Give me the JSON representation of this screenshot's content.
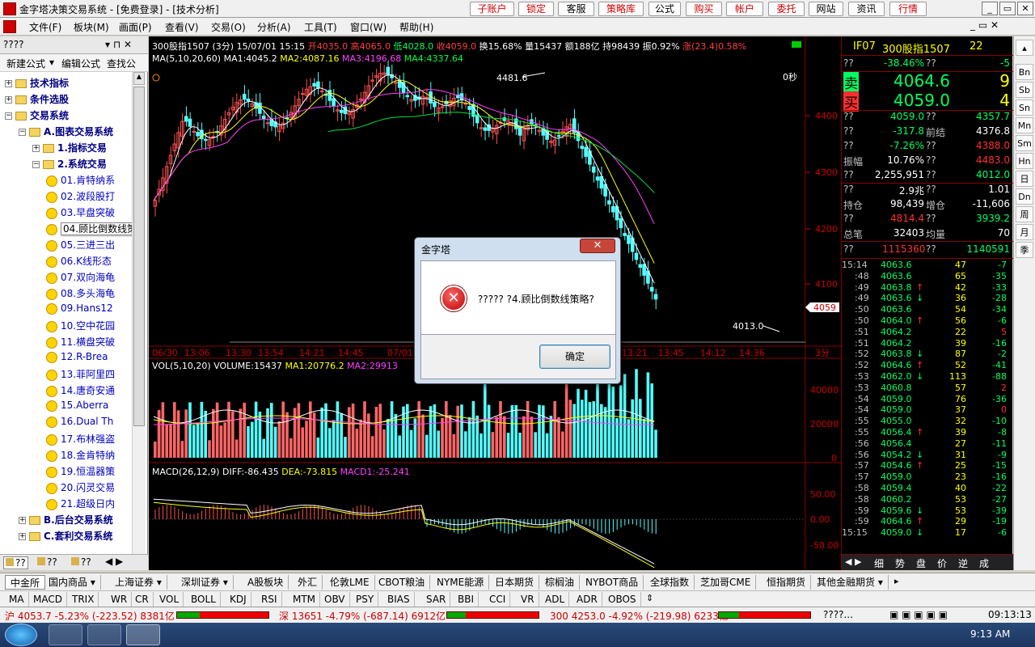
{
  "window": {
    "title": "金字塔决策交易系统 - [免费登录] - [技术分析]",
    "top_buttons": [
      "子账户",
      "锁定",
      "客服",
      "策略库",
      "公式",
      "购买",
      "帐户",
      "委托",
      "网站",
      "资讯",
      "行情"
    ],
    "controls": [
      "_",
      "▭",
      "✕"
    ]
  },
  "menu": [
    "文件(F)",
    "板块(M)",
    "画面(P)",
    "查看(V)",
    "交易(O)",
    "分析(A)",
    "工具(T)",
    "窗口(W)",
    "帮助(H)"
  ],
  "left_panel": {
    "header": "????",
    "tools": [
      "新建公式",
      "编辑公式",
      "查找公"
    ],
    "tree": [
      {
        "level": 0,
        "type": "folder",
        "label": "技术指标",
        "expander": "+"
      },
      {
        "level": 0,
        "type": "folder",
        "label": "条件选股",
        "expander": "+"
      },
      {
        "level": 0,
        "type": "folder",
        "label": "交易系统",
        "expander": "−"
      },
      {
        "level": 1,
        "type": "folder",
        "label": "A.图表交易系统",
        "expander": "−"
      },
      {
        "level": 2,
        "type": "folder",
        "label": "1.指标交易",
        "expander": "+"
      },
      {
        "level": 2,
        "type": "folder",
        "label": "2.系统交易",
        "expander": "−"
      },
      {
        "level": 3,
        "type": "item",
        "label": "01.肯特纳系"
      },
      {
        "level": 3,
        "type": "item",
        "label": "02.波段股打"
      },
      {
        "level": 3,
        "type": "item",
        "label": "03.早盘突破"
      },
      {
        "level": 3,
        "type": "item",
        "label": "04.顾比倒数线策略",
        "selected": true
      },
      {
        "level": 3,
        "type": "item",
        "label": "05.三进三出"
      },
      {
        "level": 3,
        "type": "item",
        "label": "06.K线形态"
      },
      {
        "level": 3,
        "type": "item",
        "label": "07.双向海龟"
      },
      {
        "level": 3,
        "type": "item",
        "label": "08.多头海龟"
      },
      {
        "level": 3,
        "type": "item",
        "label": "09.Hans12"
      },
      {
        "level": 3,
        "type": "item",
        "label": "10.空中花园"
      },
      {
        "level": 3,
        "type": "item",
        "label": "11.横盘突破"
      },
      {
        "level": 3,
        "type": "item",
        "label": "12.R-Brea"
      },
      {
        "level": 3,
        "type": "item",
        "label": "13.菲阿里四"
      },
      {
        "level": 3,
        "type": "item",
        "label": "14.唐奇安通"
      },
      {
        "level": 3,
        "type": "item",
        "label": "15.Aberra"
      },
      {
        "level": 3,
        "type": "item",
        "label": "16.Dual Th"
      },
      {
        "level": 3,
        "type": "item",
        "label": "17.布林强盗"
      },
      {
        "level": 3,
        "type": "item",
        "label": "18.金肯特纳"
      },
      {
        "level": 3,
        "type": "item",
        "label": "19.恒温器策"
      },
      {
        "level": 3,
        "type": "item",
        "label": "20.闪灵交易"
      },
      {
        "level": 3,
        "type": "item",
        "label": "21.超级日内"
      },
      {
        "level": 1,
        "type": "folder",
        "label": "B.后台交易系统",
        "expander": "+"
      },
      {
        "level": 1,
        "type": "folder",
        "label": "C.套利交易系统",
        "expander": "+"
      }
    ],
    "tabs": [
      "??",
      "??",
      "??"
    ]
  },
  "chart_header": {
    "line1": [
      {
        "t": "300股指1507 (3分) 15/07/01 15:15 ",
        "c": "#ffffff"
      },
      {
        "t": "开4035.0",
        "c": "#ff4040"
      },
      {
        "t": " 高4065.0",
        "c": "#ff4040"
      },
      {
        "t": " 低4028.0",
        "c": "#00ff60"
      },
      {
        "t": " 收4059.0",
        "c": "#ff4040"
      },
      {
        "t": " 换15.68% 量15437 额188亿 持98439 振0.92% ",
        "c": "#ffffff"
      },
      {
        "t": "涨(23.4)0.58%",
        "c": "#ff4040"
      }
    ],
    "line2": [
      {
        "t": "MA(5,10,20,60) ",
        "c": "#ffffff"
      },
      {
        "t": "MA1:4045.2",
        "c": "#ffffff"
      },
      {
        "t": " MA2:4087.16",
        "c": "#ffff00"
      },
      {
        "t": " MA3:4196.68",
        "c": "#ff40ff"
      },
      {
        "t": " MA4:4337.64",
        "c": "#00ff40"
      }
    ],
    "zero_sec": "0秒",
    "high_label": "4481.6",
    "low_label": "4013.0",
    "last_price_tag": "4059",
    "y_labels": [
      "4400",
      "4300",
      "4200",
      "4100"
    ],
    "x_labels": [
      "06/30",
      "13:06",
      "13:30",
      "13:54",
      "14:21",
      "14:45",
      "07/01",
      "13:21",
      "13:45",
      "14:12",
      "14:36"
    ],
    "period_label": "3分"
  },
  "vol_header": [
    {
      "t": "VOL(5,10,20) ",
      "c": "#ffffff"
    },
    {
      "t": "VOLUME:15437",
      "c": "#ffffff"
    },
    {
      "t": " MA1:20776.2",
      "c": "#ffff00"
    },
    {
      "t": " MA2:29913",
      "c": "#ff40ff"
    }
  ],
  "vol_y": [
    "40000",
    "20000",
    "0"
  ],
  "macd_header": [
    {
      "t": "MACD(26,12,9) ",
      "c": "#ffffff"
    },
    {
      "t": "DIFF:-86.435",
      "c": "#ffffff"
    },
    {
      "t": " DEA:-73.815",
      "c": "#ffff00"
    },
    {
      "t": " MACD1:-25.241",
      "c": "#ff40ff"
    }
  ],
  "macd_y": [
    "50.00",
    "0.00",
    "-50.00"
  ],
  "quote": {
    "header": {
      "code": "IF07",
      "name": "300股指1507",
      "num": "22"
    },
    "rows": [
      {
        "l": "??",
        "v": "-38.46%",
        "l2": "??",
        "v2": "-5",
        "vc": "#00ff60",
        "v2c": "#00ff60"
      },
      {
        "l": "卖",
        "v": "4064.6",
        "l2": "",
        "v2": "9",
        "vc": "#00ff60",
        "v2c": "#ffff00",
        "big": true,
        "lc": "#00ff60"
      },
      {
        "l": "买",
        "v": "4059.0",
        "l2": "",
        "v2": "4",
        "vc": "#00ff60",
        "v2c": "#ffff00",
        "big": true,
        "lc": "#ff3030"
      },
      {
        "l": "??",
        "v": "4059.0",
        "l2": "??",
        "v2": "4357.7",
        "vc": "#00ff60",
        "v2c": "#00ff60"
      },
      {
        "l": "??",
        "v": "-317.8",
        "l2": "前结",
        "v2": "4376.8",
        "vc": "#00ff60",
        "v2c": "#ffffff"
      },
      {
        "l": "??",
        "v": "-7.26%",
        "l2": "??",
        "v2": "4388.0",
        "vc": "#00ff60",
        "v2c": "#ff3030"
      },
      {
        "l": "振幅",
        "v": "10.76%",
        "l2": "??",
        "v2": "4483.0",
        "vc": "#ffffff",
        "v2c": "#ff3030"
      },
      {
        "l": "??",
        "v": "2,255,951",
        "l2": "??",
        "v2": "4012.0",
        "vc": "#ffffff",
        "v2c": "#00ff60"
      },
      {
        "l": "??",
        "v": "2.9兆",
        "l2": "??",
        "v2": "1.01",
        "vc": "#ffffff",
        "v2c": "#ffffff"
      },
      {
        "l": "持仓",
        "v": "98,439",
        "l2": "增仓",
        "v2": "-11,606",
        "vc": "#ffffff",
        "v2c": "#ffffff"
      },
      {
        "l": "??",
        "v": "4814.4",
        "l2": "??",
        "v2": "3939.2",
        "vc": "#ff3030",
        "v2c": "#00ff60"
      },
      {
        "l": "总笔",
        "v": "32403",
        "l2": "均量",
        "v2": "70",
        "vc": "#ffffff",
        "v2c": "#ffffff"
      }
    ],
    "out_in": {
      "l": "??",
      "v": "1115360",
      "l2": "??",
      "v2": "1140591"
    },
    "ticks": [
      {
        "t": "15:14",
        "p": "4063.6",
        "a": "",
        "v": "47",
        "d": "-7"
      },
      {
        "t": ":48",
        "p": "4063.6",
        "a": "",
        "v": "65",
        "d": "-35"
      },
      {
        "t": ":49",
        "p": "4063.8",
        "a": "↑",
        "v": "42",
        "d": "-33"
      },
      {
        "t": ":49",
        "p": "4063.6",
        "a": "↓",
        "v": "36",
        "d": "-28"
      },
      {
        "t": ":50",
        "p": "4063.6",
        "a": "",
        "v": "54",
        "d": "-34"
      },
      {
        "t": ":50",
        "p": "4064.0",
        "a": "↑",
        "v": "56",
        "d": "-6"
      },
      {
        "t": ":51",
        "p": "4064.2",
        "a": "",
        "v": "22",
        "d": "5"
      },
      {
        "t": ":51",
        "p": "4064.2",
        "a": "",
        "v": "39",
        "d": "-16"
      },
      {
        "t": ":52",
        "p": "4063.8",
        "a": "↓",
        "v": "87",
        "d": "-2"
      },
      {
        "t": ":52",
        "p": "4064.6",
        "a": "↑",
        "v": "52",
        "d": "-41"
      },
      {
        "t": ":53",
        "p": "4062.0",
        "a": "↓",
        "v": "113",
        "d": "-88"
      },
      {
        "t": ":53",
        "p": "4060.8",
        "a": "",
        "v": "57",
        "d": "2"
      },
      {
        "t": ":54",
        "p": "4059.0",
        "a": "",
        "v": "76",
        "d": "-36"
      },
      {
        "t": ":54",
        "p": "4059.0",
        "a": "",
        "v": "37",
        "d": "0"
      },
      {
        "t": ":55",
        "p": "4055.0",
        "a": "",
        "v": "32",
        "d": "-10"
      },
      {
        "t": ":55",
        "p": "4056.4",
        "a": "↑",
        "v": "39",
        "d": "-8"
      },
      {
        "t": ":56",
        "p": "4056.4",
        "a": "",
        "v": "27",
        "d": "-11"
      },
      {
        "t": ":56",
        "p": "4054.2",
        "a": "↓",
        "v": "31",
        "d": "-9"
      },
      {
        "t": ":57",
        "p": "4054.6",
        "a": "↑",
        "v": "25",
        "d": "-15"
      },
      {
        "t": ":57",
        "p": "4059.0",
        "a": "",
        "v": "23",
        "d": "-16"
      },
      {
        "t": ":58",
        "p": "4059.4",
        "a": "",
        "v": "40",
        "d": "-22"
      },
      {
        "t": ":58",
        "p": "4060.2",
        "a": "",
        "v": "53",
        "d": "-27"
      },
      {
        "t": ":59",
        "p": "4059.6",
        "a": "↓",
        "v": "53",
        "d": "-39"
      },
      {
        "t": ":59",
        "p": "4064.6",
        "a": "↑",
        "v": "29",
        "d": "-19"
      },
      {
        "t": "15:15",
        "p": "4059.0",
        "a": "↓",
        "v": "17",
        "d": "-6"
      }
    ],
    "bottom_tabs": [
      "细",
      "势",
      "盘",
      "价",
      "逆",
      "成"
    ]
  },
  "right_strip": [
    "Bn",
    "Sb",
    "Sn",
    "Mn",
    "Sm",
    "Hn",
    "日",
    "Dn",
    "周",
    "月",
    "季"
  ],
  "market_tabs": [
    "中金所",
    "国内商品 ▾",
    "上海证券 ▾",
    "深圳证券 ▾",
    "A股板块",
    "外汇",
    "伦敦LME",
    "CBOT粮油",
    "NYME能源",
    "日本期货",
    "棕榈油",
    "NYBOT商品",
    "全球指数",
    "芝加哥CME",
    "恒指期货",
    "其他金融期货 ▾"
  ],
  "indicator_tabs": [
    "MA",
    "MACD",
    "TRIX",
    "WR",
    "CR",
    "VOL",
    "BOLL",
    "KDJ",
    "RSI",
    "MTM",
    "OBV",
    "PSY",
    "BIAS",
    "SAR",
    "BBI",
    "CCI",
    "VR",
    "ADL",
    "ADR",
    "OBOS"
  ],
  "ticker": {
    "sh": "沪 4053.7 -5.23% (-223.52) 8381亿",
    "sz": "深 13651 -4.79% (-687.14) 6912亿",
    "hs": "300 4253.0 -4.92% (-219.98) 6233亿",
    "status": "????...",
    "time": "09:13:13"
  },
  "taskbar": {
    "clock": "9:13 AM"
  },
  "dialog": {
    "title": "金字塔",
    "close": "✕",
    "icon": "✕",
    "message": "????? ?4.顾比倒数线策略?",
    "ok": "确定"
  }
}
